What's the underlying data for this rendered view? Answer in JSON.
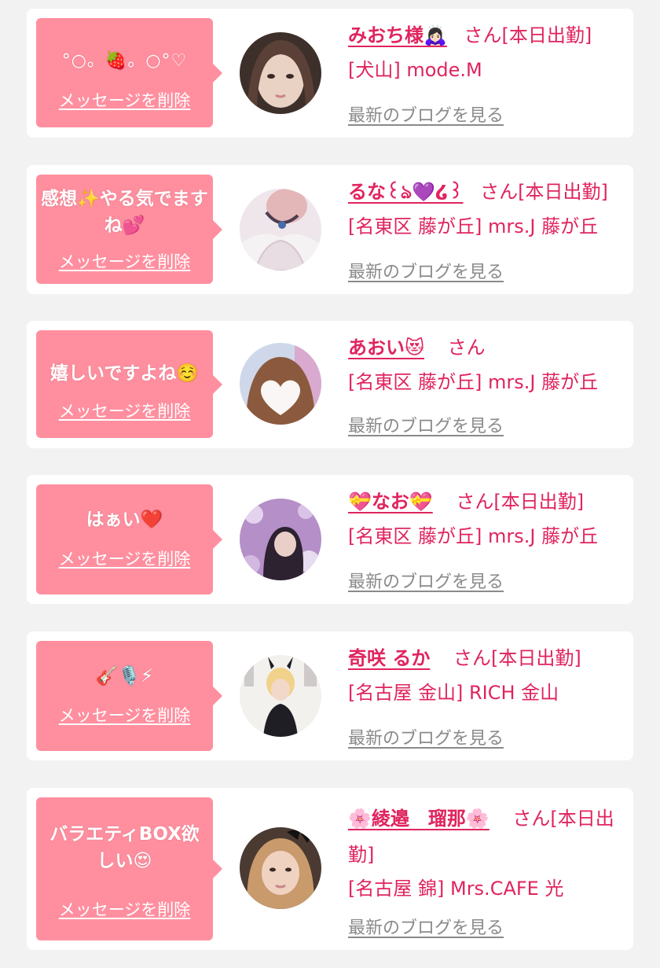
{
  "messages": [
    {
      "message": "°○。🍓。○°♡",
      "delete_label": "メッセージを削除",
      "girl_name": "みおち様🙇🏻‍♀️",
      "suffix": "さん[本日出勤]",
      "shop": "[犬山] mode.M",
      "blog_label": "最新のブログを見る",
      "avatar_icon": "portrait-brown-hair"
    },
    {
      "message": "感想✨やる気でますね💕",
      "delete_label": "メッセージを削除",
      "girl_name": "るな꒰ঌ💜໒꒱",
      "suffix": "さん[本日出勤]",
      "shop": "[名東区 藤が丘] mrs.J 藤が丘",
      "blog_label": "最新のブログを見る",
      "avatar_icon": "portrait-lace-dress"
    },
    {
      "message": "嬉しいですよね☺️",
      "delete_label": "メッセージを削除",
      "girl_name": "あおい😻",
      "suffix": "さん",
      "shop": "[名東区 藤が丘] mrs.J 藤が丘",
      "blog_label": "最新のブログを見る",
      "avatar_icon": "portrait-heart-blur"
    },
    {
      "message": "はぁい❤️",
      "delete_label": "メッセージを削除",
      "girl_name": "💝なお💝",
      "suffix": "さん[本日出勤]",
      "shop": "[名東区 藤が丘] mrs.J 藤が丘",
      "blog_label": "最新のブログを見る",
      "avatar_icon": "portrait-purple-flowers"
    },
    {
      "message": "🎸🎙️⚡",
      "delete_label": "メッセージを削除",
      "girl_name": "奇咲 るか",
      "suffix": "さん[本日出勤]",
      "shop": "[名古屋 金山] RICH 金山",
      "blog_label": "最新のブログを見る",
      "avatar_icon": "portrait-magazine-cover"
    },
    {
      "message": "バラエティBOX欲しい😍",
      "delete_label": "メッセージを削除",
      "girl_name": "🌸綾邉　瑠那🌸",
      "suffix": "さん[本日出勤]",
      "shop": "[名古屋 錦] Mrs.CAFE 光",
      "blog_label": "最新のブログを見る",
      "avatar_icon": "portrait-dark-bow"
    }
  ],
  "colors": {
    "background": "#f2f2f2",
    "card": "#ffffff",
    "bubble": "#ff8f9f",
    "name": "#e0245e",
    "blog_link": "#8a8a8a"
  }
}
